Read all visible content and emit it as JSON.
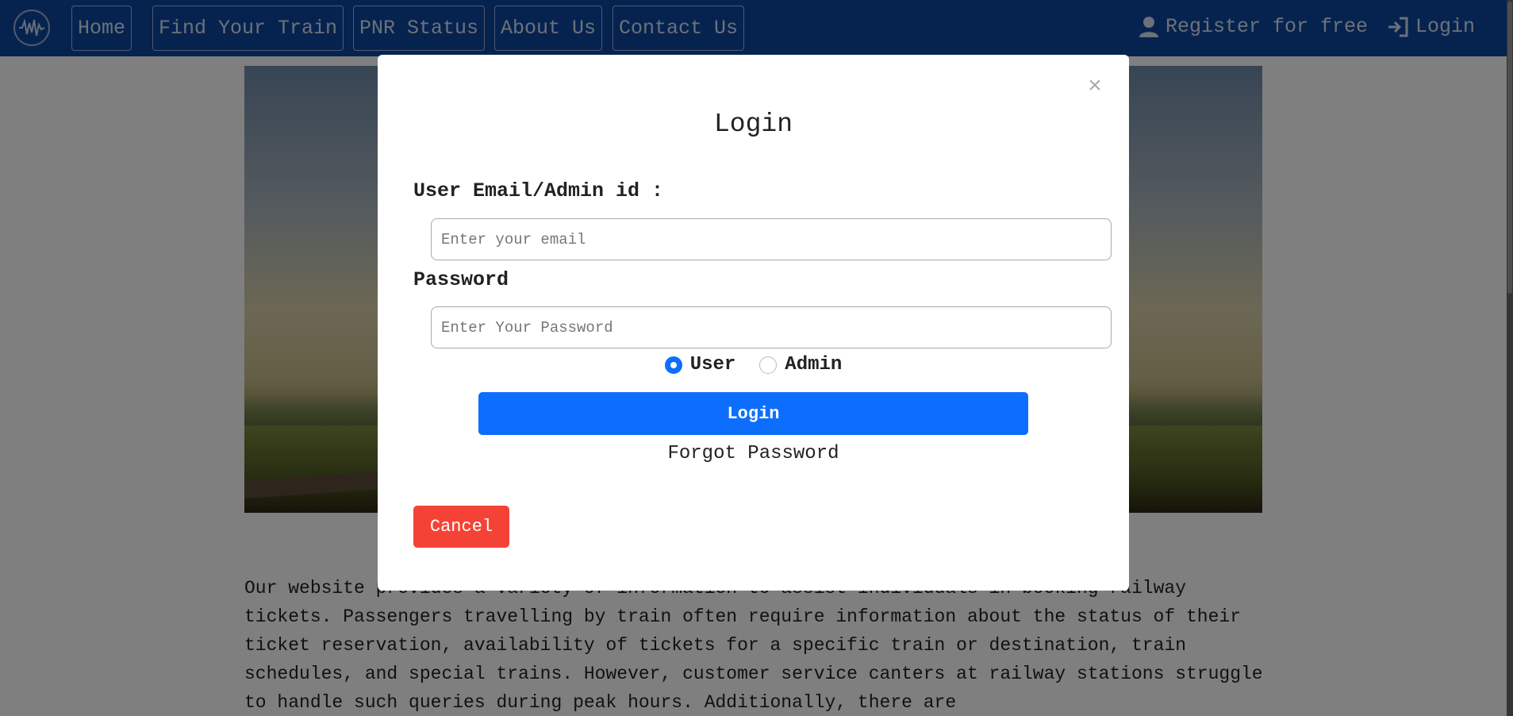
{
  "navbar": {
    "items": [
      {
        "label": "Home"
      },
      {
        "label": "Find Your Train"
      },
      {
        "label": "PNR Status"
      },
      {
        "label": "About Us"
      },
      {
        "label": "Contact Us"
      }
    ],
    "register_label": "Register for free",
    "login_label": "Login"
  },
  "page": {
    "about_text": "Our website provides a variety of information to assist individuals in booking railway tickets. Passengers travelling by train often require information about the status of their ticket reservation, availability of tickets for a specific train or destination, train schedules, and special trains. However, customer service canters at railway stations struggle to handle such queries during peak hours. Additionally, there are"
  },
  "modal": {
    "close_glyph": "×",
    "title": "Login",
    "email_label": "User Email/Admin id :",
    "email_placeholder": "Enter your email",
    "password_label": "Password",
    "password_placeholder": "Enter Your Password",
    "role_options": [
      "User",
      "Admin"
    ],
    "selected_role": "User",
    "login_button": "Login",
    "forgot_link": "Forgot Password",
    "cancel_button": "Cancel"
  },
  "colors": {
    "navbar": "#0d47a1",
    "primary": "#0d6efd",
    "danger": "#f44336"
  }
}
